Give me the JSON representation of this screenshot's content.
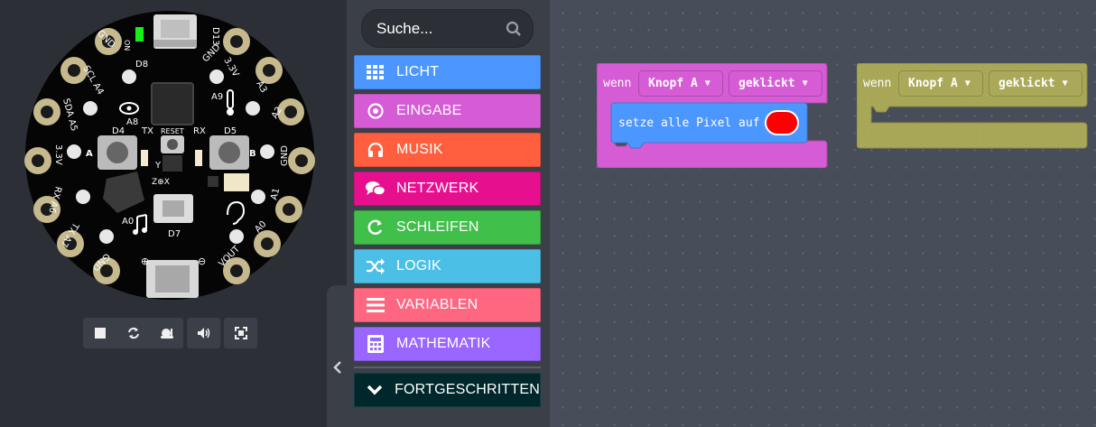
{
  "simulator": {
    "pin_labels": {
      "gnd_tl": "GND",
      "scl_a4": "SCL A4",
      "sda_a5": "SDA A5",
      "v33_l": "3.3V",
      "rx_a6": "RX A6",
      "tx_a7": "TX A7",
      "gnd_bl": "GND",
      "gnd_tr": "GND",
      "v33_tr": "3.3V",
      "a3": "A3",
      "a2": "A2",
      "gnd_r": "GND",
      "a1": "A1",
      "a0": "A0",
      "vout": "VOUT",
      "d8": "D8",
      "d13": "D13",
      "a8": "A8",
      "a9": "A9",
      "d4": "D4",
      "d5": "D5",
      "tx": "TX",
      "rx": "RX",
      "reset": "RESET",
      "a": "A",
      "b": "B",
      "a0_in": "A0",
      "d7": "D7",
      "on": "ON",
      "y": "Y",
      "zx": "Z⊕X",
      "plus": "⊕",
      "minus": "⊖"
    },
    "controls": {
      "stop": "stop-icon",
      "restart": "refresh-icon",
      "slowmo": "snail-icon",
      "mute": "volume-icon",
      "fullscreen": "fullscreen-icon"
    }
  },
  "toolbox": {
    "search_placeholder": "Suche...",
    "categories": [
      {
        "label": "LICHT",
        "color": "#4c97ff",
        "icon": "grid-icon"
      },
      {
        "label": "EINGABE",
        "color": "#d65cd6",
        "icon": "target-icon"
      },
      {
        "label": "MUSIK",
        "color": "#ff5f3f",
        "icon": "headphones-icon"
      },
      {
        "label": "NETZWERK",
        "color": "#e6108f",
        "icon": "chat-icon"
      },
      {
        "label": "SCHLEIFEN",
        "color": "#40bf4a",
        "icon": "loop-icon"
      },
      {
        "label": "LOGIK",
        "color": "#4cbfe6",
        "icon": "shuffle-icon"
      },
      {
        "label": "VARIABLEN",
        "color": "#ff6680",
        "icon": "list-icon"
      },
      {
        "label": "MATHEMATIK",
        "color": "#9966ff",
        "icon": "calculator-icon"
      }
    ],
    "advanced": {
      "label": "FORTGESCHRITTEN",
      "color": "#00272b",
      "icon": "chevron-down-icon"
    }
  },
  "workspace": {
    "block1": {
      "hat": "wenn",
      "button": "Knopf A",
      "event": "geklickt",
      "stmt": "setze alle Pixel auf",
      "pixel_color": "#ff0000",
      "color": "#d65cd6",
      "stmt_color": "#4c97ff"
    },
    "block2": {
      "hat": "wenn",
      "button": "Knopf A",
      "event": "geklickt",
      "color": "#aaa95a",
      "state": "disabled"
    }
  }
}
